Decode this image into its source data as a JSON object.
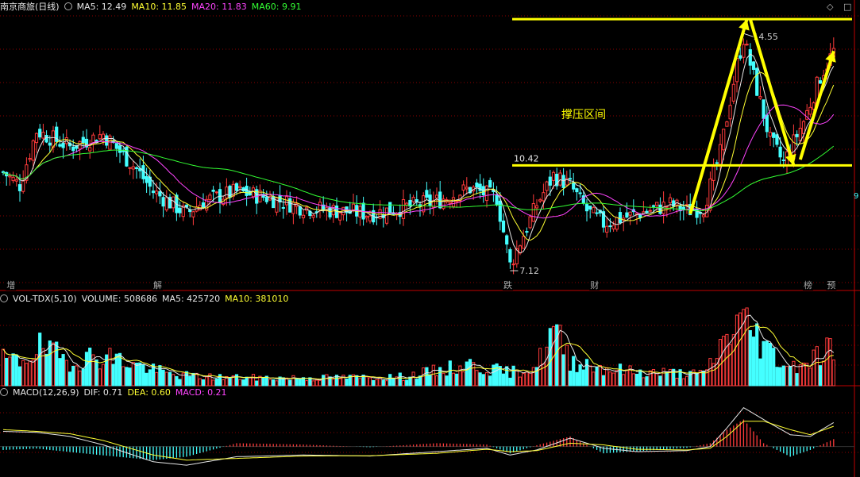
{
  "header_main": {
    "title": "南京商旅(日线)",
    "ma5": "MA5: 12.49",
    "ma10": "MA10: 11.85",
    "ma20": "MA20: 11.83",
    "ma60": "MA60: 9.91"
  },
  "header_volume": {
    "name": "VOL-TDX(5,10)",
    "volume": "VOLUME: 508686",
    "ma5": "MA5: 425720",
    "ma10": "MA10: 381010"
  },
  "header_macd": {
    "name": "MACD(12,26,9)",
    "dif": "DIF: 0.71",
    "dea": "DEA: 0.60",
    "macd": "MACD: 0.21"
  },
  "annotations": {
    "high_label": "14.55",
    "low_label": "7.12",
    "support_label": "10.42",
    "zone_text": "撑压区间",
    "right_edge_label": "9"
  },
  "event_markers": [
    {
      "label": "增",
      "index": 1
    },
    {
      "label": "解",
      "index": 45
    },
    {
      "label": "跌",
      "index": 150
    },
    {
      "label": "财",
      "index": 176
    },
    {
      "label": "榜",
      "index": 240
    },
    {
      "label": "预",
      "index": 247
    }
  ],
  "colors": {
    "up": "#ff3b3b",
    "down": "#44ffff",
    "ma5": "#e6e6e6",
    "ma10": "#ffff33",
    "ma20": "#ff44ff",
    "ma60": "#33ff33",
    "grid": "#8b0000",
    "annotation": "#ffff00"
  },
  "chart_data": {
    "type": "candlestick",
    "count": 250,
    "price_range": [
      6.6,
      15.3
    ],
    "price_points": [
      [
        0,
        10.2
      ],
      [
        5,
        9.8
      ],
      [
        10,
        11.5
      ],
      [
        20,
        11.0
      ],
      [
        30,
        11.4
      ],
      [
        40,
        10.3
      ],
      [
        45,
        9.6
      ],
      [
        55,
        8.9
      ],
      [
        60,
        9.3
      ],
      [
        70,
        9.6
      ],
      [
        80,
        9.4
      ],
      [
        90,
        9.1
      ],
      [
        100,
        9.0
      ],
      [
        110,
        8.9
      ],
      [
        120,
        9.1
      ],
      [
        130,
        9.3
      ],
      [
        140,
        9.7
      ],
      [
        148,
        9.4
      ],
      [
        152,
        7.3
      ],
      [
        160,
        9.2
      ],
      [
        165,
        10.1
      ],
      [
        170,
        9.8
      ],
      [
        175,
        9.0
      ],
      [
        180,
        8.6
      ],
      [
        190,
        8.9
      ],
      [
        200,
        9.2
      ],
      [
        205,
        9.0
      ],
      [
        210,
        9.1
      ],
      [
        215,
        10.8
      ],
      [
        220,
        13.6
      ],
      [
        222,
        14.4
      ],
      [
        226,
        12.8
      ],
      [
        230,
        11.2
      ],
      [
        234,
        10.5
      ],
      [
        240,
        11.8
      ],
      [
        245,
        13.2
      ],
      [
        249,
        14.0
      ]
    ],
    "special_points": [
      {
        "name": "high",
        "value": 14.55,
        "index": 222
      },
      {
        "name": "low",
        "value": 7.12,
        "index": 152
      }
    ],
    "support_level": 10.42,
    "resistance_level": 15.0,
    "volume_range": [
      0,
      1000000
    ],
    "volume_points": [
      [
        0,
        320000
      ],
      [
        5,
        300000
      ],
      [
        10,
        480000
      ],
      [
        20,
        310000
      ],
      [
        30,
        380000
      ],
      [
        40,
        260000
      ],
      [
        50,
        140000
      ],
      [
        60,
        110000
      ],
      [
        80,
        95000
      ],
      [
        100,
        100000
      ],
      [
        120,
        110000
      ],
      [
        140,
        260000
      ],
      [
        148,
        190000
      ],
      [
        152,
        160000
      ],
      [
        160,
        250000
      ],
      [
        165,
        690000
      ],
      [
        170,
        320000
      ],
      [
        180,
        220000
      ],
      [
        190,
        170000
      ],
      [
        200,
        160000
      ],
      [
        210,
        140000
      ],
      [
        215,
        480000
      ],
      [
        220,
        820000
      ],
      [
        225,
        690000
      ],
      [
        230,
        420000
      ],
      [
        236,
        230000
      ],
      [
        244,
        380000
      ],
      [
        249,
        508686
      ]
    ],
    "macd_range": [
      -0.9,
      1.4
    ],
    "dif_points": [
      [
        0,
        0.45
      ],
      [
        10,
        0.42
      ],
      [
        20,
        0.3
      ],
      [
        30,
        0.05
      ],
      [
        45,
        -0.45
      ],
      [
        55,
        -0.55
      ],
      [
        70,
        -0.3
      ],
      [
        90,
        -0.25
      ],
      [
        110,
        -0.28
      ],
      [
        130,
        -0.15
      ],
      [
        145,
        -0.05
      ],
      [
        152,
        -0.25
      ],
      [
        160,
        -0.1
      ],
      [
        170,
        0.25
      ],
      [
        180,
        -0.05
      ],
      [
        190,
        -0.15
      ],
      [
        205,
        -0.12
      ],
      [
        212,
        0.0
      ],
      [
        217,
        0.55
      ],
      [
        222,
        1.15
      ],
      [
        228,
        0.8
      ],
      [
        236,
        0.35
      ],
      [
        242,
        0.3
      ],
      [
        249,
        0.71
      ]
    ],
    "dea_points": [
      [
        0,
        0.5
      ],
      [
        10,
        0.45
      ],
      [
        20,
        0.38
      ],
      [
        30,
        0.18
      ],
      [
        45,
        -0.25
      ],
      [
        55,
        -0.4
      ],
      [
        70,
        -0.35
      ],
      [
        90,
        -0.28
      ],
      [
        110,
        -0.27
      ],
      [
        130,
        -0.2
      ],
      [
        145,
        -0.08
      ],
      [
        152,
        -0.15
      ],
      [
        160,
        -0.12
      ],
      [
        170,
        0.1
      ],
      [
        180,
        0.05
      ],
      [
        190,
        -0.08
      ],
      [
        205,
        -0.1
      ],
      [
        212,
        -0.05
      ],
      [
        217,
        0.3
      ],
      [
        222,
        0.75
      ],
      [
        228,
        0.75
      ],
      [
        236,
        0.5
      ],
      [
        242,
        0.35
      ],
      [
        249,
        0.6
      ]
    ]
  }
}
